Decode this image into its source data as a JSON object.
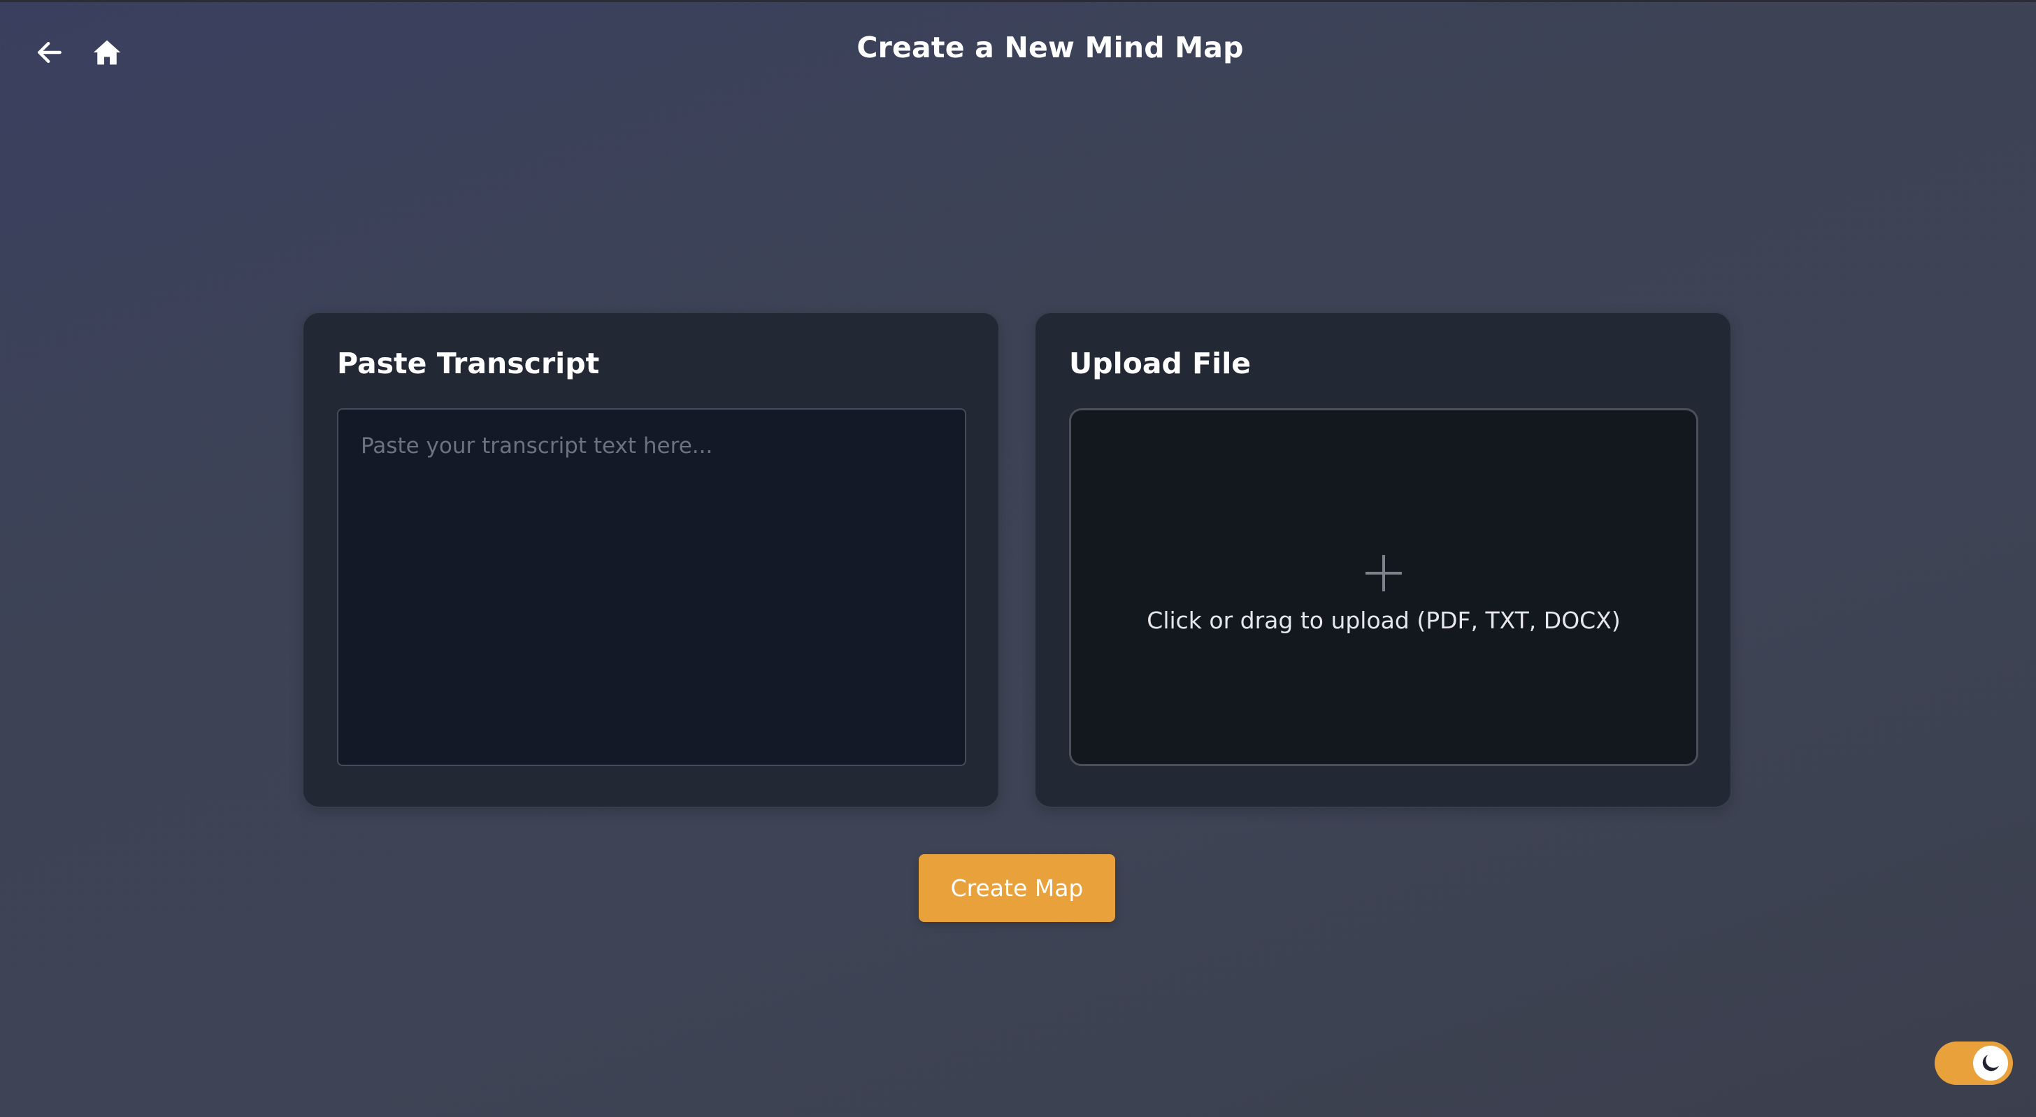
{
  "header": {
    "title": "Create a New Mind Map",
    "back_icon": "arrow-left-icon",
    "home_icon": "home-icon"
  },
  "transcript_card": {
    "title": "Paste Transcript",
    "input_value": "",
    "input_placeholder": "Paste your transcript text here..."
  },
  "upload_card": {
    "title": "Upload File",
    "icon": "plus-icon",
    "prompt": "Click or drag to upload (PDF, TXT, DOCX)"
  },
  "actions": {
    "create_label": "Create Map"
  },
  "theme_toggle": {
    "icon": "moon-icon",
    "mode": "dark"
  },
  "colors": {
    "accent": "#e9a23b",
    "card_bg": "#232934",
    "input_bg": "#131927",
    "upload_bg": "#13181f"
  }
}
